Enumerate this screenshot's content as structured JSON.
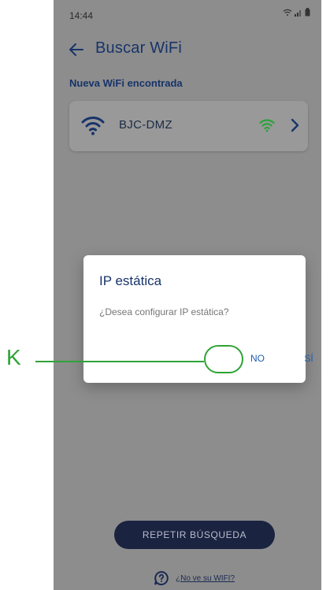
{
  "status_bar": {
    "time": "14:44",
    "icons": [
      "wifi-icon",
      "cell-signal-icon",
      "battery-icon"
    ]
  },
  "app_bar": {
    "back_icon": "arrow-left-icon",
    "title": "Buscar WiFi"
  },
  "section": {
    "label": "Nueva WiFi encontrada"
  },
  "networks": [
    {
      "ssid": "BJC-DMZ",
      "icon": "wifi-icon",
      "signal_icon": "wifi-signal-icon",
      "chevron_icon": "chevron-right-icon"
    }
  ],
  "dialog": {
    "title": "IP estática",
    "message": "¿Desea configurar IP estática?",
    "no_label": "NO",
    "yes_label": "SÍ"
  },
  "footer": {
    "repeat_label": "REPETIR BÚSQUEDA",
    "help_icon": "help-chat-icon",
    "help_label": "¿No ve su WIFI?"
  },
  "annotation": {
    "label": "K",
    "color": "#2fa336"
  },
  "colors": {
    "primary": "#17346a",
    "accent_green": "#2aa33a",
    "button_dark": "#1a2340",
    "dialog_action": "#1f5fb0"
  }
}
